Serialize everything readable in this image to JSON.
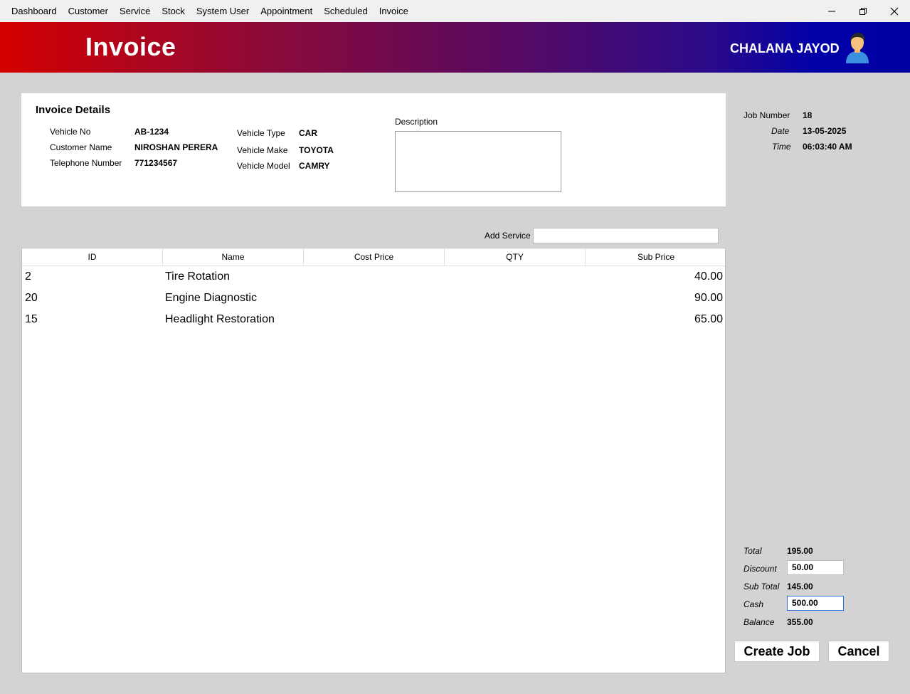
{
  "menu": {
    "items": [
      "Dashboard",
      "Customer",
      "Service",
      "Stock",
      "System User",
      "Appointment",
      "Scheduled",
      "Invoice"
    ]
  },
  "window": {
    "minimize": "—",
    "restore": "❐",
    "close": "✕"
  },
  "header": {
    "title": "Invoice",
    "user_name": "CHALANA JAYOD"
  },
  "details": {
    "title": "Invoice Details",
    "vehicle_no_label": "Vehicle No",
    "vehicle_no": "AB-1234",
    "customer_name_label": "Customer Name",
    "customer_name": "NIROSHAN PERERA",
    "telephone_label": "Telephone Number",
    "telephone": "771234567",
    "vehicle_type_label": "Vehicle Type",
    "vehicle_type": "CAR",
    "vehicle_make_label": "Vehicle Make",
    "vehicle_make": "TOYOTA",
    "vehicle_model_label": "Vehicle Model",
    "vehicle_model": "CAMRY",
    "description_label": "Description",
    "description": ""
  },
  "job": {
    "job_number_label": "Job Number",
    "job_number": "18",
    "date_label": "Date",
    "date": "13-05-2025",
    "time_label": "Time",
    "time": "06:03:40 AM"
  },
  "add_service": {
    "label": "Add Service",
    "value": ""
  },
  "table": {
    "columns": [
      "ID",
      "Name",
      "Cost Price",
      "QTY",
      "Sub Price"
    ],
    "rows": [
      {
        "id": "2",
        "name": "Tire Rotation",
        "sub_price": "40.00"
      },
      {
        "id": "20",
        "name": "Engine Diagnostic",
        "sub_price": "90.00"
      },
      {
        "id": "15",
        "name": "Headlight Restoration",
        "sub_price": "65.00"
      }
    ]
  },
  "totals": {
    "total_label": "Total",
    "total": "195.00",
    "discount_label": "Discount",
    "discount": "50.00",
    "sub_total_label": "Sub Total",
    "sub_total": "145.00",
    "cash_label": "Cash",
    "cash": "500.00",
    "balance_label": "Balance",
    "balance": "355.00"
  },
  "buttons": {
    "create_job": "Create Job",
    "cancel": "Cancel"
  },
  "colors": {
    "header_start": "#d40000",
    "header_end": "#0000a8",
    "background": "#d3d3d3",
    "focus_border": "#2a6fd6"
  }
}
